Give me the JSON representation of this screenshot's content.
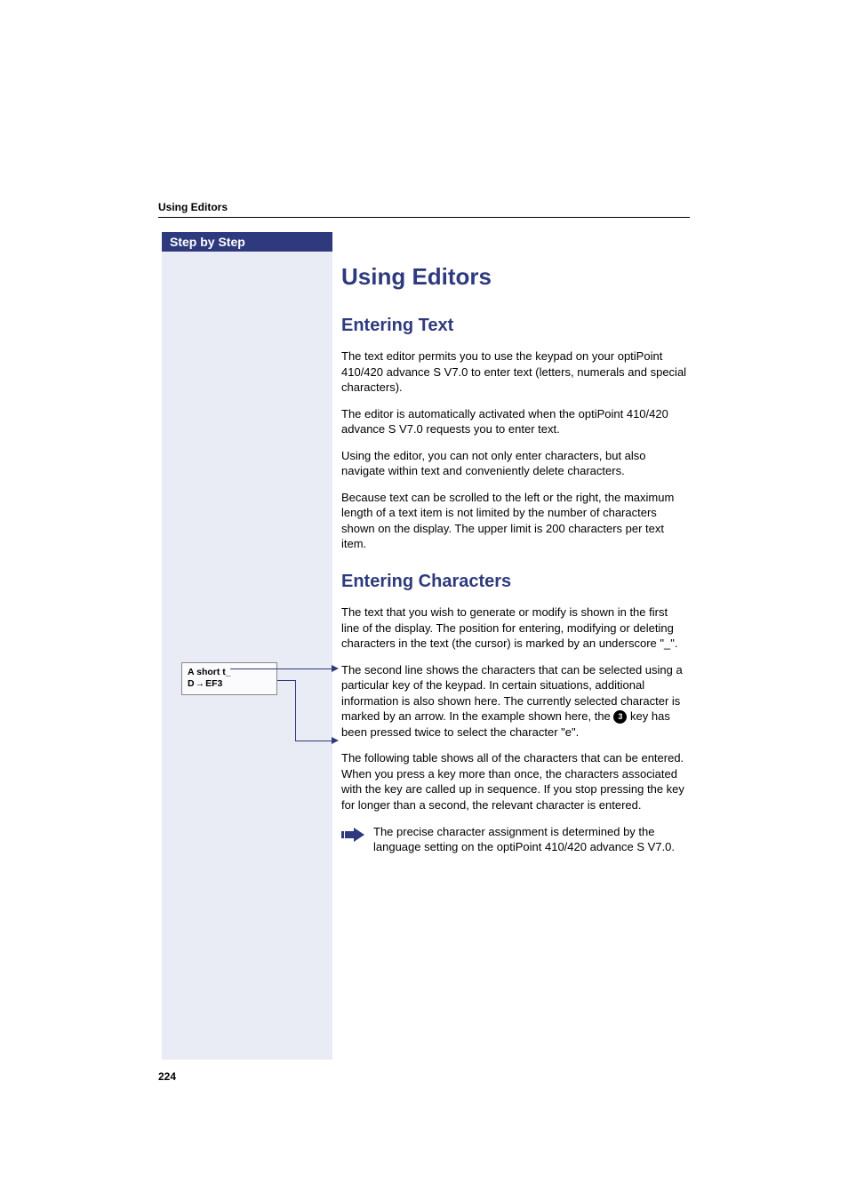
{
  "header": {
    "running_title": "Using Editors"
  },
  "sidebar": {
    "ribbon": "Step by Step"
  },
  "display_box": {
    "line1": "A short t_",
    "line2_prefix": "D",
    "line2_arrow": "→",
    "line2_suffix": "EF3"
  },
  "content": {
    "title": "Using Editors",
    "section1": {
      "heading": "Entering Text",
      "p1": "The text editor permits you to use the keypad on your optiPoint 410/420 advance S V7.0 to enter text (letters, numerals and special characters).",
      "p2": "The editor is automatically activated when the optiPoint 410/420 advance S V7.0 requests you to enter text.",
      "p3": "Using the editor, you can not only enter characters, but also navigate within text and conveniently delete characters.",
      "p4": "Because text can be scrolled to the left or the right, the maximum length of a text item is not limited by the number of characters shown on the display. The upper limit is 200 characters per text item."
    },
    "section2": {
      "heading": "Entering Characters",
      "p1": "The text that you wish to generate or modify is shown in the first line of the display. The position for entering, modifying or deleting characters in the text (the cursor) is marked by an underscore  \"_\".",
      "p2a": "The second line shows the characters that can be selected using a particular key of the keypad. In certain situations, additional information is also shown here. The currently selected character is marked by an arrow. In the example shown here, the ",
      "p2_key": "3",
      "p2b": " key has been pressed twice to select the character \"e\".",
      "p3": "The following table shows all of the characters that can be entered. When you press a key more than once, the characters associated with the key are called up in sequence. If you stop pressing the key for longer than a second, the relevant character is entered.",
      "note": "The precise character assignment is determined by the language setting on the optiPoint 410/420 advance S V7.0."
    }
  },
  "page_number": "224"
}
